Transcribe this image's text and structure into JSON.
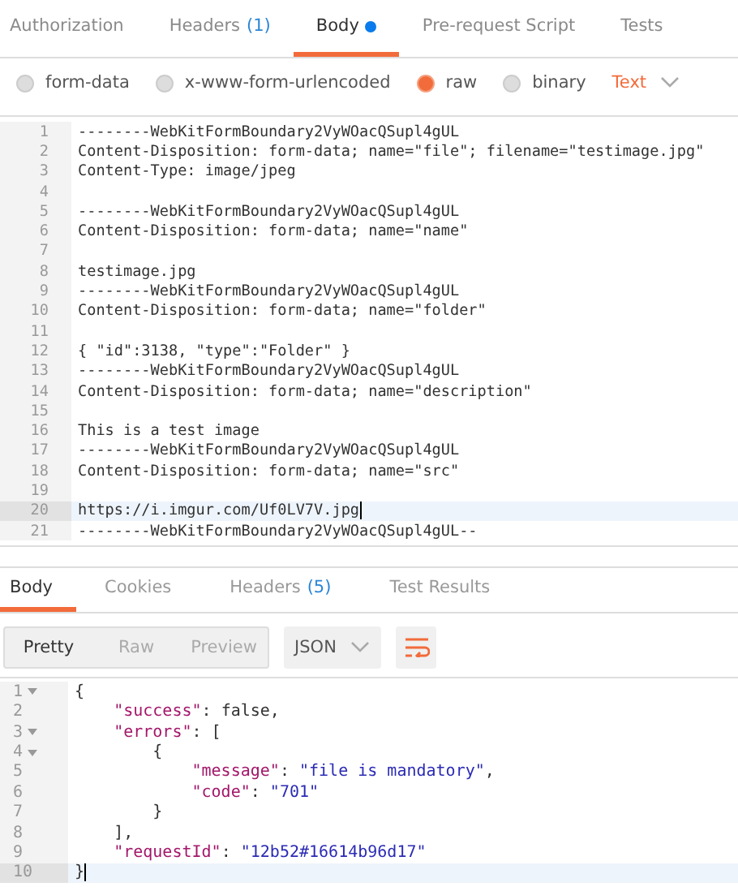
{
  "request_tabs": [
    {
      "label": "Authorization",
      "selected": false,
      "dot": false
    },
    {
      "label": "Headers",
      "count": "(1)",
      "selected": false,
      "dot": false
    },
    {
      "label": "Body",
      "selected": true,
      "dot": true
    },
    {
      "label": "Pre-request Script",
      "selected": false,
      "dot": false
    },
    {
      "label": "Tests",
      "selected": false,
      "dot": false
    }
  ],
  "body_modes": [
    {
      "label": "form-data",
      "selected": false
    },
    {
      "label": "x-www-form-urlencoded",
      "selected": false
    },
    {
      "label": "raw",
      "selected": true
    },
    {
      "label": "binary",
      "selected": false
    }
  ],
  "raw_type": "Text",
  "request_editor": [
    {
      "number": "1",
      "text": "--------WebKitFormBoundary2VyWOacQSupl4gUL",
      "current": false
    },
    {
      "number": "2",
      "text": "Content-Disposition: form-data; name=\"file\"; filename=\"testimage.jpg\"",
      "current": false
    },
    {
      "number": "3",
      "text": "Content-Type: image/jpeg",
      "current": false
    },
    {
      "number": "4",
      "current": false
    },
    {
      "number": "5",
      "text": "--------WebKitFormBoundary2VyWOacQSupl4gUL",
      "current": false
    },
    {
      "number": "6",
      "text": "Content-Disposition: form-data; name=\"name\"",
      "current": false
    },
    {
      "number": "7",
      "current": false
    },
    {
      "number": "8",
      "text": "testimage.jpg",
      "current": false
    },
    {
      "number": "9",
      "text": "--------WebKitFormBoundary2VyWOacQSupl4gUL",
      "current": false
    },
    {
      "number": "10",
      "text": "Content-Disposition: form-data; name=\"folder\"",
      "current": false
    },
    {
      "number": "11",
      "current": false
    },
    {
      "number": "12",
      "text": "{ \"id\":3138, \"type\":\"Folder\" }",
      "current": false
    },
    {
      "number": "13",
      "text": "--------WebKitFormBoundary2VyWOacQSupl4gUL",
      "current": false
    },
    {
      "number": "14",
      "text": "Content-Disposition: form-data; name=\"description\"",
      "current": false
    },
    {
      "number": "15",
      "current": false
    },
    {
      "number": "16",
      "text": "This is a test image",
      "current": false
    },
    {
      "number": "17",
      "text": "--------WebKitFormBoundary2VyWOacQSupl4gUL",
      "current": false
    },
    {
      "number": "18",
      "text": "Content-Disposition: form-data; name=\"src\"",
      "current": false
    },
    {
      "number": "19",
      "current": false
    },
    {
      "number": "20",
      "text": "https://i.imgur.com/Uf0LV7V.jpg",
      "current": true
    },
    {
      "number": "21",
      "text": "--------WebKitFormBoundary2VyWOacQSupl4gUL--",
      "current": false
    }
  ],
  "response_tabs": [
    {
      "label": "Body",
      "selected": true
    },
    {
      "label": "Cookies",
      "selected": false
    },
    {
      "label": "Headers",
      "count": "(5)",
      "selected": false
    },
    {
      "label": "Test Results",
      "selected": false
    }
  ],
  "view_modes": [
    {
      "label": "Pretty",
      "selected": true
    },
    {
      "label": "Raw",
      "selected": false
    },
    {
      "label": "Preview",
      "selected": false
    }
  ],
  "format": "JSON",
  "wrap_on": true,
  "response_editor": [
    {
      "number": "1",
      "foldable": true,
      "current": false,
      "segments": [
        {
          "kind": "plain",
          "text": "{"
        }
      ]
    },
    {
      "number": "2",
      "foldable": false,
      "current": false,
      "segments": [
        {
          "kind": "key",
          "text": "    \"success\""
        },
        {
          "kind": "plain",
          "text": ": false,"
        }
      ]
    },
    {
      "number": "3",
      "foldable": true,
      "current": false,
      "segments": [
        {
          "kind": "key",
          "text": "    \"errors\""
        },
        {
          "kind": "plain",
          "text": ": ["
        }
      ]
    },
    {
      "number": "4",
      "foldable": true,
      "current": false,
      "segments": [
        {
          "kind": "plain",
          "text": "        {"
        }
      ]
    },
    {
      "number": "5",
      "foldable": false,
      "current": false,
      "segments": [
        {
          "kind": "key",
          "text": "            \"message\""
        },
        {
          "kind": "plain",
          "text": ": "
        },
        {
          "kind": "string",
          "text": "\"file is mandatory\""
        },
        {
          "kind": "plain",
          "text": ","
        }
      ]
    },
    {
      "number": "6",
      "foldable": false,
      "current": false,
      "segments": [
        {
          "kind": "key",
          "text": "            \"code\""
        },
        {
          "kind": "plain",
          "text": ": "
        },
        {
          "kind": "string",
          "text": "\"701\""
        }
      ]
    },
    {
      "number": "7",
      "foldable": false,
      "current": false,
      "segments": [
        {
          "kind": "plain",
          "text": "        }"
        }
      ]
    },
    {
      "number": "8",
      "foldable": false,
      "current": false,
      "segments": [
        {
          "kind": "plain",
          "text": "    ],"
        }
      ]
    },
    {
      "number": "9",
      "foldable": false,
      "current": false,
      "segments": [
        {
          "kind": "key",
          "text": "    \"requestId\""
        },
        {
          "kind": "plain",
          "text": ": "
        },
        {
          "kind": "string",
          "text": "\"12b52#16614b96d17\""
        }
      ]
    },
    {
      "number": "10",
      "foldable": false,
      "current": true,
      "segments": [
        {
          "kind": "plain",
          "text": "}"
        }
      ]
    }
  ]
}
